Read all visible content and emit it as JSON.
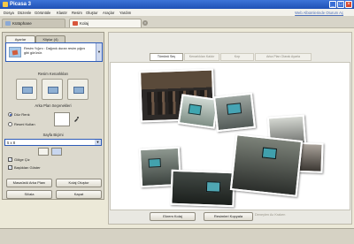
{
  "window": {
    "title": "Picasa 3",
    "buttons": {
      "minimize": "_",
      "maximize": "□",
      "close": "×"
    }
  },
  "menu": {
    "items": [
      "Dosya",
      "Düzenle",
      "Görüntüle",
      "Klasör",
      "Resim",
      "Oluştur",
      "Araçlar",
      "Yardım"
    ],
    "signin": "Web Albümlerinde Oturum Aç"
  },
  "tabs": {
    "library": "Kütüphane",
    "collage": "Kolaj",
    "close": "×"
  },
  "left_panel": {
    "subtabs": {
      "settings": "Ayarlar",
      "clips": "Kliplər (4)"
    },
    "preset": {
      "text": "Resim Yığını : Dağınık duran resim yığını gibi görünür."
    },
    "picture_options_label": "Resim Kenarlıkları",
    "background_label": "Arka Plan Seçenekleri",
    "radio_solid": "Düz Renk",
    "radio_image": "Resmi Kullan",
    "page_format_label": "Sayfa Biçimi",
    "page_format_value": "5 x 8",
    "checkbox_shadows": "Gölge Çiz",
    "checkbox_captions": "Başlıkları Göster",
    "button_edit_background": "Masaüstü Arka Planı",
    "button_add_clips": "Kolaj Oluştur",
    "button_clear": "Sil/ala",
    "button_close": "Kapat"
  },
  "work_tabs": {
    "tab1": "Tümünü Seç",
    "tab2": "Kenarlıkları Kaldır",
    "tab3": "Kırp",
    "tab4": "Arka Plan Olarak Ayarla"
  },
  "bottom_buttons": {
    "edit": "Ekrem Kolaj",
    "export": "Resimleri Kopyala",
    "disabled": "Deneylen Ac Kraken"
  },
  "colors": {
    "accent": "#2d5bb8",
    "titlebar": "#1f51b5",
    "panel": "#dcd9cd",
    "canvas": "#ffffff"
  }
}
